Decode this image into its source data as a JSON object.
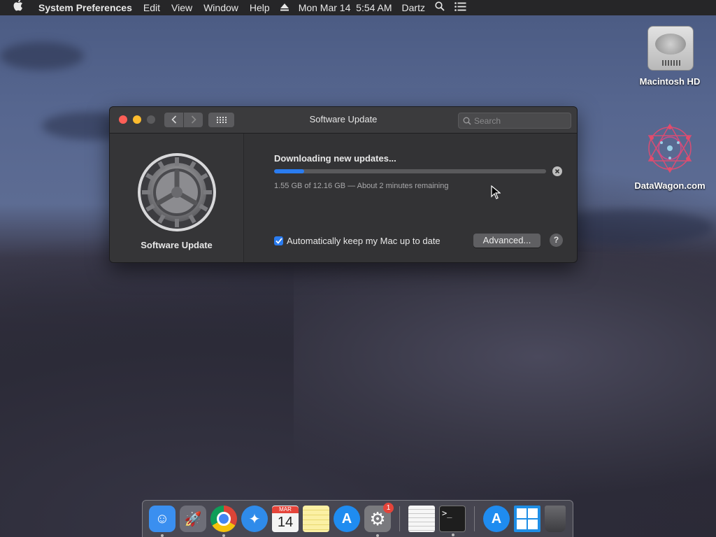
{
  "menubar": {
    "apple_icon": "apple-logo-icon",
    "app_name": "System Preferences",
    "menus": [
      "Edit",
      "View",
      "Window",
      "Help"
    ],
    "clock": "Mon Mar 14  5:54 AM",
    "user": "Dartz"
  },
  "desktop": {
    "icons": [
      {
        "label": "Macintosh HD",
        "icon": "hard-drive-icon"
      },
      {
        "label": "DataWagon.com",
        "icon": "datawagon-logo-icon"
      }
    ]
  },
  "window": {
    "title": "Software Update",
    "search_placeholder": "Search",
    "pane_label": "Software Update",
    "download_title": "Downloading new updates...",
    "download_status": "1.55 GB of 12.16 GB — About 2 minutes remaining",
    "progress_fraction": 0.11,
    "auto_update_label": "Automatically keep my Mac up to date",
    "auto_update_checked": true,
    "advanced_button": "Advanced...",
    "help_button": "?"
  },
  "dock": {
    "items": [
      {
        "name": "finder-icon",
        "color": "#3a8ff0",
        "running": true
      },
      {
        "name": "launchpad-icon",
        "color": "#6e6e78",
        "running": false
      },
      {
        "name": "chrome-icon",
        "color": "#e8e8e8",
        "running": true
      },
      {
        "name": "safari-icon",
        "color": "#2f8bea",
        "running": false
      },
      {
        "name": "calendar-icon",
        "color": "#f4f4f4",
        "running": false,
        "month": "MAR",
        "day": "14"
      },
      {
        "name": "notes-icon",
        "color": "#f5e27a",
        "running": false
      },
      {
        "name": "app-store-icon",
        "color": "#1f8cf0",
        "running": false
      },
      {
        "name": "system-preferences-icon",
        "color": "#7a7a7e",
        "running": true,
        "badge": "1"
      },
      {
        "name": "textedit-icon",
        "color": "#f0f0f0",
        "running": false
      },
      {
        "name": "terminal-icon",
        "color": "#1e1e1e",
        "running": true
      },
      {
        "name": "app-store-downloads-icon",
        "color": "#1f8cf0",
        "running": false
      },
      {
        "name": "windows-icon",
        "color": "#3aa6f2",
        "running": false
      },
      {
        "name": "trash-icon",
        "color": "#4a4a4e",
        "running": false
      }
    ]
  }
}
